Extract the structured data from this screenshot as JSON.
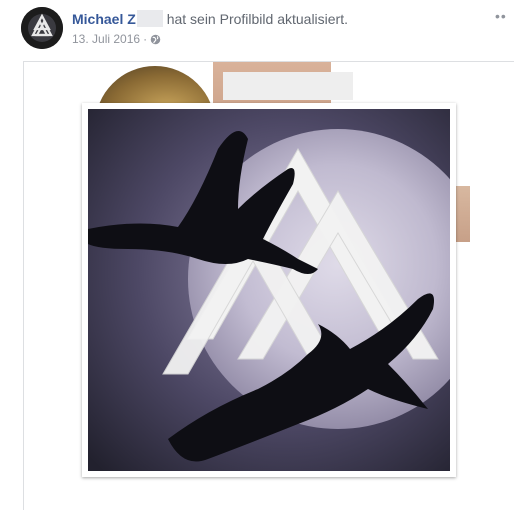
{
  "post": {
    "author": "Michael Z",
    "action": "hat sein Profilbild aktualisiert.",
    "date": "13. Juli 2016",
    "separator": "·",
    "privacy_icon": "globe-icon",
    "more_icon": "more-options-icon",
    "more_glyph": "••"
  },
  "media": {
    "profile_image": "valknut-ravens-moon-image",
    "cover_image": "cover-photo"
  },
  "colors": {
    "link": "#365899",
    "meta": "#90949c",
    "text": "#4b4f56"
  }
}
